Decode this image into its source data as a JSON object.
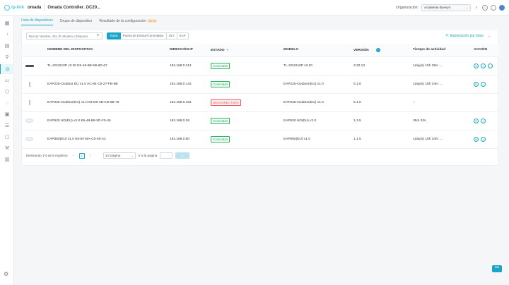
{
  "header": {
    "brand": "tp-link",
    "product": "omada",
    "site_name": "Omada Controller_OC20...",
    "org_label": "Organización:",
    "org_value": "Academia Buenyo"
  },
  "sidebar": {
    "items": [
      {
        "icon": "dashboard-icon"
      },
      {
        "icon": "statistics-icon"
      },
      {
        "icon": "map-icon"
      },
      {
        "icon": "location-icon"
      },
      {
        "icon": "devices-icon",
        "active": true
      },
      {
        "icon": "clients-icon"
      },
      {
        "icon": "insights-icon"
      },
      {
        "icon": "hotspot-icon"
      },
      {
        "icon": "schedule-icon"
      },
      {
        "icon": "logs-icon"
      },
      {
        "icon": "audit-icon"
      },
      {
        "icon": "tools-icon"
      },
      {
        "icon": "reports-icon"
      }
    ],
    "settings_icon": "settings-icon"
  },
  "tabs": [
    {
      "label": "Lista de dispositivos",
      "active": true
    },
    {
      "label": "Grupo de dispositivo"
    },
    {
      "label": "Resultado de la configuración",
      "badge": "BETA"
    }
  ],
  "toolbar": {
    "search_placeholder": "Buscar Nombre, SN, IP, Modelo o Etiqueta",
    "filters": [
      "Todos",
      "Puerta de Enlace/Controlador",
      "OLT",
      "EAP"
    ],
    "export_label": "Exportación por lotes"
  },
  "table": {
    "columns": [
      "NOMBRE DEL DISPOSITIVO",
      "DIRECCIÓN IP",
      "ESTADO",
      "MODELO",
      "VERSIÓN",
      "Tiempo de actividad",
      "ACCIÓN"
    ],
    "rows": [
      {
        "device": "switch",
        "name": "TL-SG2210P v3.20 E5-48-B8-5B-6D-67",
        "ip": "192.168.0.214",
        "status": "Conectado",
        "status_type": "online",
        "model": "TL-SG2210P v3.20",
        "version": "3.20.13",
        "uptime": "1day(s) 15h 35m ...",
        "actions": 3
      },
      {
        "device": "outdoor",
        "name": "EAP225-Outdoor EU v1.0 AC-84-C6-27-FB-BE",
        "ip": "192.168.0.142",
        "status": "Conectado",
        "status_type": "online",
        "model": "EAP225-Outdoor(EU) v1.0",
        "version": "5.1.6",
        "uptime": "1day(s) 15h 34m ...",
        "actions": 2
      },
      {
        "device": "outdoor",
        "name": "EAP225-Outdoor(EU) v1.0 84-D8-1B-CD-5B-76",
        "ip": "192.168.0.181",
        "status": "DESCONECTADO",
        "status_type": "offline",
        "model": "EAP225-Outdoor(EU) v1.0",
        "version": "5.1.6",
        "uptime": "--",
        "actions": 0
      },
      {
        "device": "ap",
        "name": "EAP620 HD(EU) v2.0 E5-48-B8-5D-F5-46",
        "ip": "192.168.0.28",
        "status": "Conectado",
        "status_type": "online",
        "model": "EAP620 HD(EU) v2.0",
        "version": "1.3.5",
        "uptime": "35m 32s",
        "actions": 2
      },
      {
        "device": "ap",
        "name": "EAP650(EU) v1.0 E5-B7-BA-C0-48-A2",
        "ip": "192.168.0.80",
        "status": "Conectado",
        "status_type": "online",
        "model": "EAP650(EU) v1.0",
        "version": "1.1.5",
        "uptime": "1day(s) 15h 34m ...",
        "actions": 2
      }
    ]
  },
  "pagination": {
    "summary": "Mostrando 1-5 de 5 registros",
    "current_page": "1",
    "page_size": "10 /página",
    "goto_label": "Ir a la página",
    "go_button": "Ir"
  },
  "colors": {
    "accent": "#1aa4c8",
    "online": "#34b36b",
    "offline": "#e8575a"
  }
}
